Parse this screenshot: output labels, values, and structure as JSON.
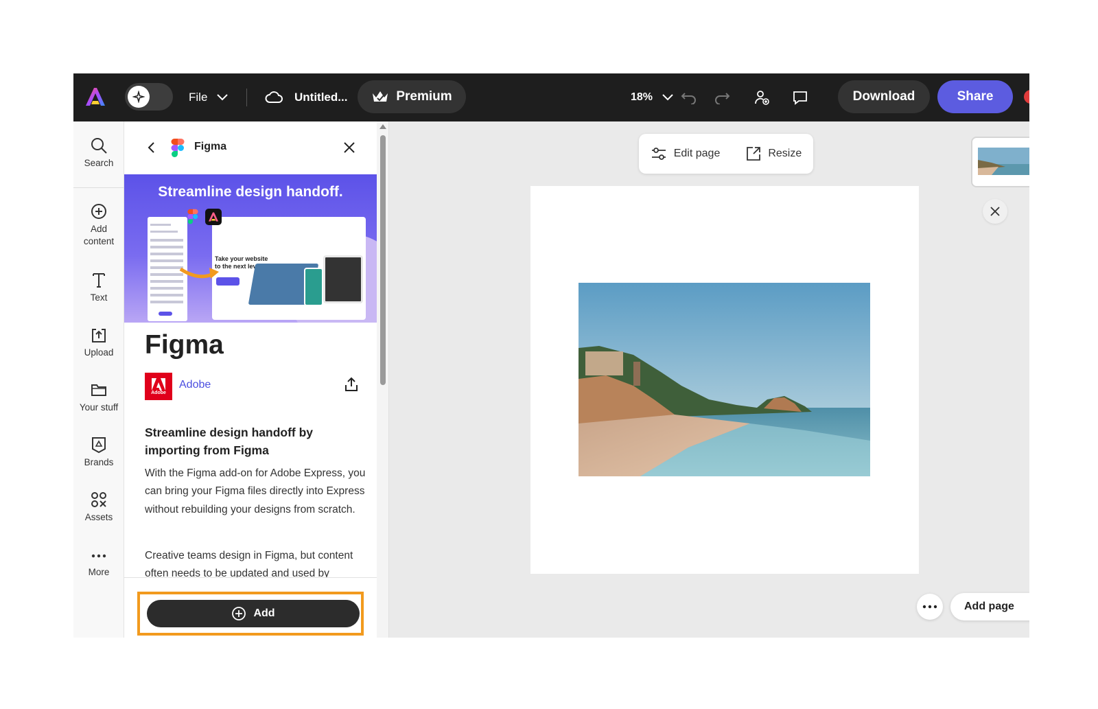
{
  "topbar": {
    "file_label": "File",
    "doc_title": "Untitled...",
    "premium_label": "Premium",
    "zoom_level": "18%",
    "download_label": "Download",
    "share_label": "Share",
    "colors": {
      "bar_bg": "#1e1e1e",
      "share_bg": "#5c5ce0",
      "highlight": "#f29a1e"
    }
  },
  "rail": {
    "items": [
      {
        "label": "Search",
        "icon": "search-icon"
      },
      {
        "label": "Add\ncontent",
        "icon": "add-circle-icon"
      },
      {
        "label": "Text",
        "icon": "text-icon"
      },
      {
        "label": "Upload",
        "icon": "upload-icon"
      },
      {
        "label": "Your stuff",
        "icon": "folder-icon"
      },
      {
        "label": "Brands",
        "icon": "brands-icon"
      },
      {
        "label": "Assets",
        "icon": "assets-icon"
      },
      {
        "label": "More",
        "icon": "more-icon"
      }
    ]
  },
  "panel": {
    "title": "Figma",
    "banner_headline": "Streamline design handoff.",
    "banner_tagline": "Take your website to the next level",
    "addon_name": "Figma",
    "publisher": "Adobe",
    "publisher_logo_text": "Adobe",
    "desc_heading": "Streamline design handoff by importing from Figma",
    "desc_body": "With the Figma add-on for Adobe Express, you can bring your Figma files directly into Express without rebuilding your designs from scratch.",
    "desc_more": "Creative teams design in Figma, but content often needs to be updated and used by",
    "add_label": "Add"
  },
  "canvas": {
    "edit_page_label": "Edit page",
    "resize_label": "Resize",
    "add_page_label": "Add page"
  }
}
